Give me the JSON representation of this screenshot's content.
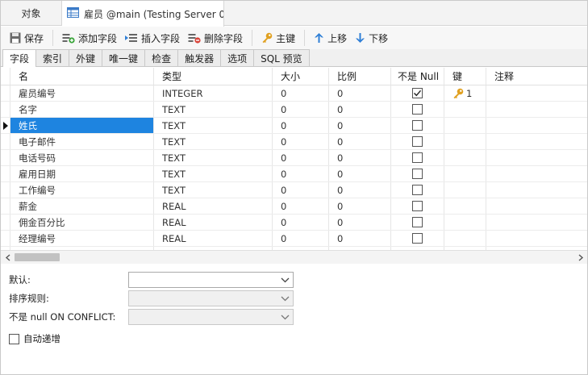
{
  "doc_tabs": [
    {
      "label": "对象"
    },
    {
      "label": "雇员 @main (Testing Server 0..."
    }
  ],
  "toolbar": {
    "save": "保存",
    "add_field": "添加字段",
    "insert_field": "插入字段",
    "delete_field": "删除字段",
    "primary_key": "主键",
    "move_up": "上移",
    "move_down": "下移"
  },
  "sub_tabs": [
    "字段",
    "索引",
    "外键",
    "唯一键",
    "检查",
    "触发器",
    "选项",
    "SQL 预览"
  ],
  "grid": {
    "headers": {
      "name": "名",
      "type": "类型",
      "size": "大小",
      "scale": "比例",
      "not_null": "不是 Null",
      "key": "键",
      "comment": "注释"
    },
    "rows": [
      {
        "name": "雇员编号",
        "type": "INTEGER",
        "size": "0",
        "scale": "0",
        "not_null": true,
        "key": "1"
      },
      {
        "name": "名字",
        "type": "TEXT",
        "size": "0",
        "scale": "0",
        "not_null": false,
        "key": ""
      },
      {
        "name": "姓氏",
        "type": "TEXT",
        "size": "0",
        "scale": "0",
        "not_null": false,
        "key": ""
      },
      {
        "name": "电子邮件",
        "type": "TEXT",
        "size": "0",
        "scale": "0",
        "not_null": false,
        "key": ""
      },
      {
        "name": "电话号码",
        "type": "TEXT",
        "size": "0",
        "scale": "0",
        "not_null": false,
        "key": ""
      },
      {
        "name": "雇用日期",
        "type": "TEXT",
        "size": "0",
        "scale": "0",
        "not_null": false,
        "key": ""
      },
      {
        "name": "工作编号",
        "type": "TEXT",
        "size": "0",
        "scale": "0",
        "not_null": false,
        "key": ""
      },
      {
        "name": "薪金",
        "type": "REAL",
        "size": "0",
        "scale": "0",
        "not_null": false,
        "key": ""
      },
      {
        "name": "佣金百分比",
        "type": "REAL",
        "size": "0",
        "scale": "0",
        "not_null": false,
        "key": ""
      },
      {
        "name": "经理编号",
        "type": "REAL",
        "size": "0",
        "scale": "0",
        "not_null": false,
        "key": ""
      }
    ],
    "selected_row": 2
  },
  "properties": {
    "default_label": "默认:",
    "default_value": "",
    "collation_label": "排序规则:",
    "collation_value": "",
    "on_conflict_label": "不是 null ON CONFLICT:",
    "on_conflict_value": "",
    "autoincrement_label": "自动递增",
    "autoincrement_checked": false
  },
  "colors": {
    "selection": "#1e84e0",
    "key_icon": "#e0a020",
    "arrow_icon": "#2f7fd6"
  }
}
